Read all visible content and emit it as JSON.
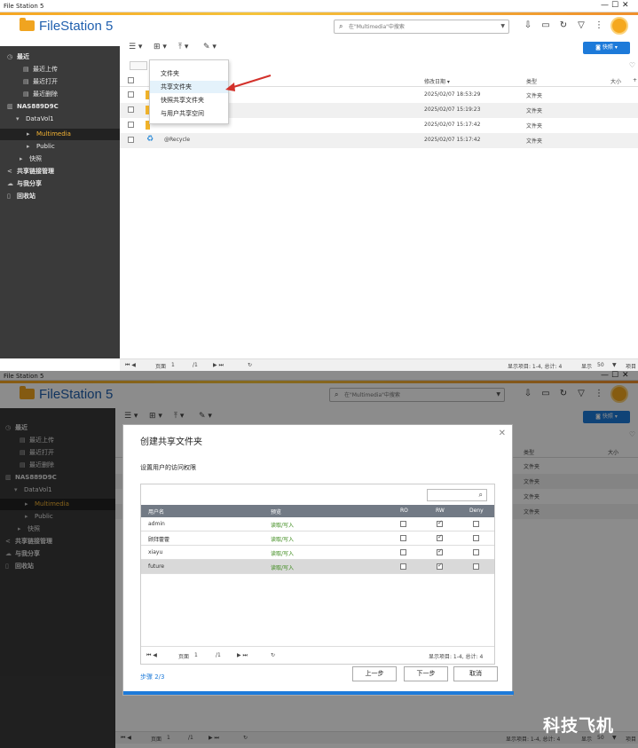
{
  "screens": [
    {
      "window_title": "File Station 5",
      "window_controls": [
        "—",
        "☐",
        "✕"
      ],
      "app_name": "FileStation 5",
      "search_placeholder": "在\"Multimedia\"中搜索",
      "sidebar": {
        "recent": "最近",
        "recent_upload": "最近上传",
        "recent_open": "最近打开",
        "recent_delete": "最近删除",
        "nas": "NAS889D9C",
        "datavol": "DataVol1",
        "multimedia": "Multimedia",
        "public": "Public",
        "snapshot": "快照",
        "share_link": "共享链接管理",
        "shared_with_me": "与我分享",
        "recycle": "回收站"
      },
      "snapshot_button": "快照",
      "columns": {
        "modified": "修改日期",
        "type": "类型",
        "size": "大小"
      },
      "rows": [
        {
          "name": "",
          "modified": "2025/02/07 18:53:29",
          "type": "文件夹"
        },
        {
          "name": "",
          "modified": "2025/02/07 15:19:23",
          "type": "文件夹"
        },
        {
          "name": "",
          "modified": "2025/02/07 15:17:42",
          "type": "文件夹"
        },
        {
          "name": "@Recycle",
          "modified": "2025/02/07 15:17:42",
          "type": "文件夹"
        }
      ],
      "menu": [
        "文件夹",
        "共享文件夹",
        "快照共享文件夹",
        "与用户共享空间"
      ],
      "status": {
        "page_label": "页面",
        "page": "1",
        "of_pages": "/1",
        "display_items": "显示项目: 1-4, 总计: 4",
        "show_label": "显示",
        "per_page": "50",
        "items_label": "项目"
      }
    },
    {
      "window_title": "File Station 5",
      "window_controls": [
        "—",
        "☐",
        "✕"
      ],
      "app_name": "FileStation 5",
      "search_placeholder": "在\"Multimedia\"中搜索",
      "sidebar": {
        "recent": "最近",
        "recent_upload": "最近上传",
        "recent_open": "最近打开",
        "recent_delete": "最近删除",
        "nas": "NAS889D9C",
        "datavol": "DataVol1",
        "multimedia": "Multimedia",
        "public": "Public",
        "snapshot": "快照",
        "share_link": "共享链接管理",
        "shared_with_me": "与我分享",
        "recycle": "回收站"
      },
      "snapshot_button": "快照",
      "bg_columns": {
        "type": "类型",
        "size": "大小"
      },
      "bg_rows": [
        "文件夹",
        "文件夹",
        "文件夹",
        "文件夹"
      ],
      "dialog": {
        "title": "创建共享文件夹",
        "subtitle": "设置用户的访问权限",
        "columns": {
          "user": "用户名",
          "preview": "预览",
          "ro": "RO",
          "rw": "RW",
          "deny": "Deny"
        },
        "users": [
          {
            "name": "admin",
            "perm": "读取/写入",
            "rw": true
          },
          {
            "name": "顾拜藿藿",
            "perm": "读取/写入",
            "rw": true
          },
          {
            "name": "xiayu",
            "perm": "读取/写入",
            "rw": true
          },
          {
            "name": "future",
            "perm": "读取/写入",
            "rw": true
          }
        ],
        "pager": {
          "page_label": "页面",
          "page": "1",
          "of_pages": "/1",
          "display_items": "显示项目: 1-4, 总计: 4"
        },
        "step": "步骤 2/3",
        "prev": "上一步",
        "next": "下一步",
        "cancel": "取消"
      },
      "status": {
        "page_label": "页面",
        "page": "1",
        "of_pages": "/1",
        "display_items": "显示项目: 1-4, 总计: 4",
        "show_label": "显示",
        "per_page": "50",
        "items_label": "项目"
      },
      "watermark": "科技飞机"
    }
  ]
}
